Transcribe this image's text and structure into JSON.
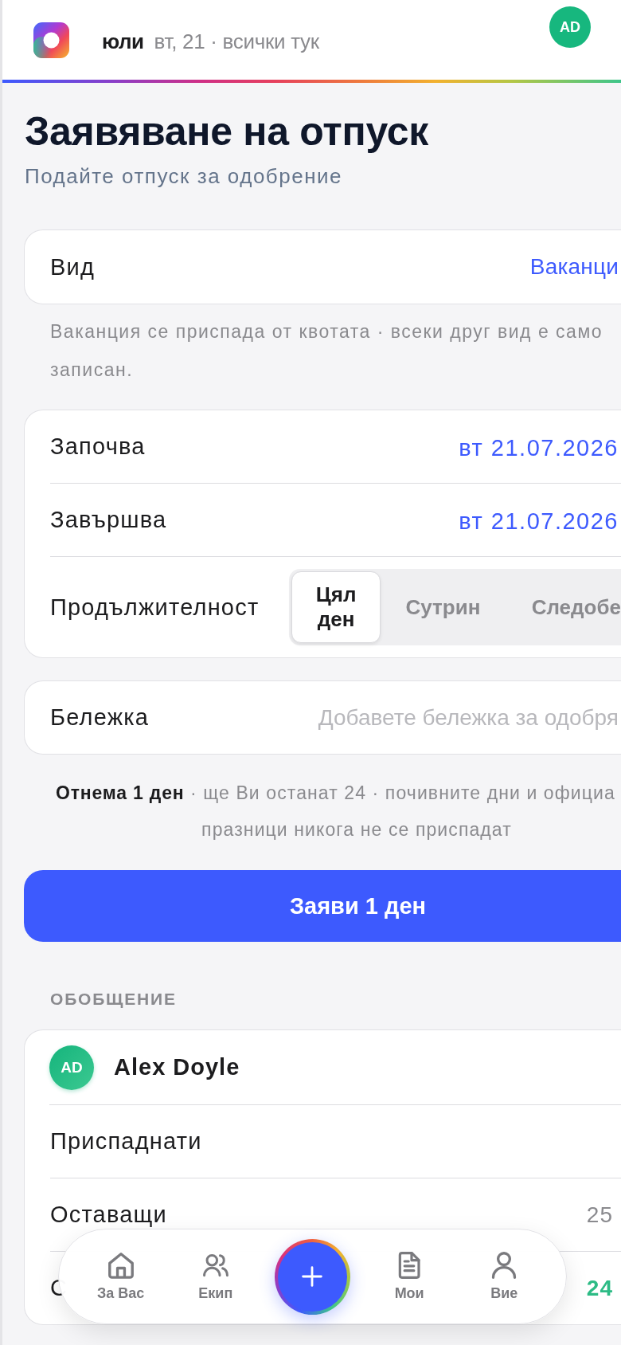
{
  "header": {
    "month": "юли",
    "date": "вт, 21 · всички тук",
    "avatar": "AD"
  },
  "page": {
    "title": "Заявяване на отпуск",
    "subtitle": "Подайте отпуск за одобрение"
  },
  "type_field": {
    "label": "Вид",
    "value": "Ваканци",
    "hint": "Ваканция се приспада от квотата · всеки друг вид е само записан."
  },
  "dates": {
    "rows": [
      {
        "label": "Започва",
        "value": "вт 21.07.2026"
      },
      {
        "label": "Завършва",
        "value": "вт 21.07.2026"
      }
    ],
    "duration": {
      "label": "Продължителност",
      "options": [
        {
          "label": "Цял ден",
          "selected": true
        },
        {
          "label": "Сутрин",
          "selected": false
        },
        {
          "label": "Следобе",
          "selected": false
        }
      ]
    }
  },
  "note_field": {
    "label": "Бележка",
    "placeholder": "Добавете бележка за одобря"
  },
  "summary_note": "**Отнема 1 ден** · ще Ви останат 24 · почивните дни и официа празници никога не се приспадат",
  "submit_button": "Заяви 1 ден",
  "summary": {
    "heading": "ОБОБЩЕНИЕ",
    "person": {
      "initials": "AD",
      "name": "Alex Doyle"
    },
    "rows": [
      {
        "label": "Приспаднати"
      },
      {
        "label": "Оставащи",
        "value": "25",
        "kind": "plain"
      },
      {
        "label": "С",
        "value": "24",
        "kind": "highlight"
      }
    ]
  },
  "nav": {
    "items": [
      {
        "label": "За Вас",
        "selected": false
      },
      {
        "label": "Екип",
        "selected": false
      },
      {
        "label": "Мои",
        "selected": false
      },
      {
        "label": "Вие",
        "selected": false
      }
    ]
  }
}
